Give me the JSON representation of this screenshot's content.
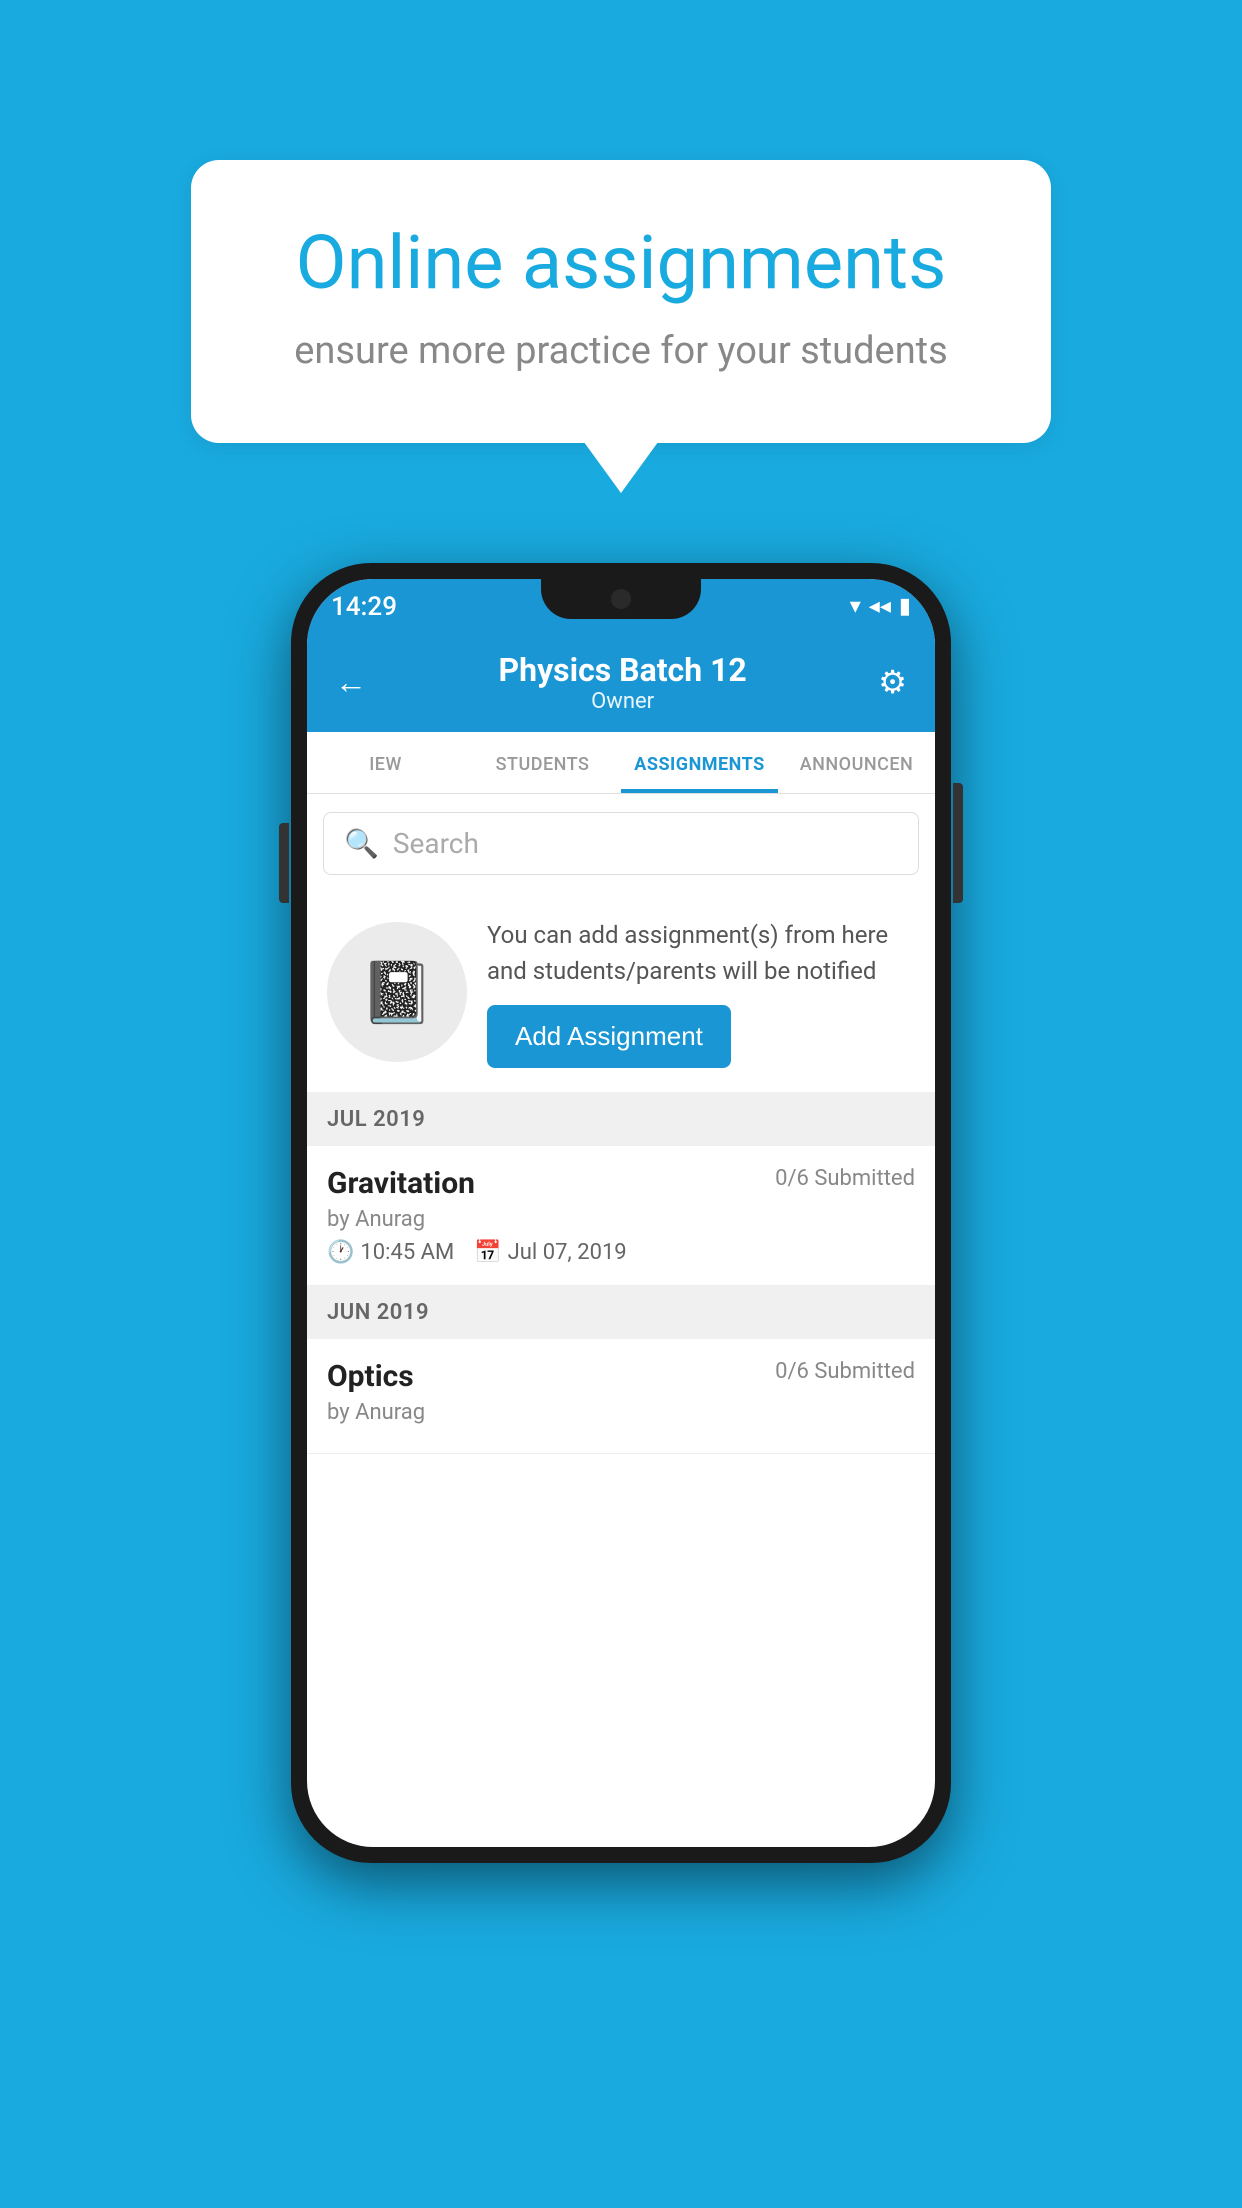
{
  "background_color": "#19AADF",
  "bubble": {
    "title": "Online assignments",
    "subtitle": "ensure more practice for your students"
  },
  "phone": {
    "status_bar": {
      "time": "14:29",
      "wifi": "▾",
      "signal": "▴▴",
      "battery": "▮"
    },
    "header": {
      "title": "Physics Batch 12",
      "subtitle": "Owner",
      "back_label": "←",
      "settings_label": "⚙"
    },
    "tabs": [
      {
        "id": "iew",
        "label": "IEW",
        "active": false
      },
      {
        "id": "students",
        "label": "STUDENTS",
        "active": false
      },
      {
        "id": "assignments",
        "label": "ASSIGNMENTS",
        "active": true
      },
      {
        "id": "announcements",
        "label": "ANNOUNCEN",
        "active": false
      }
    ],
    "search": {
      "placeholder": "Search"
    },
    "info_card": {
      "description": "You can add assignment(s) from here and students/parents will be notified",
      "button_label": "Add Assignment"
    },
    "sections": [
      {
        "month": "JUL 2019",
        "assignments": [
          {
            "name": "Gravitation",
            "submitted": "0/6 Submitted",
            "author": "by Anurag",
            "time": "10:45 AM",
            "date": "Jul 07, 2019"
          }
        ]
      },
      {
        "month": "JUN 2019",
        "assignments": [
          {
            "name": "Optics",
            "submitted": "0/6 Submitted",
            "author": "by Anurag",
            "time": "",
            "date": ""
          }
        ]
      }
    ]
  }
}
